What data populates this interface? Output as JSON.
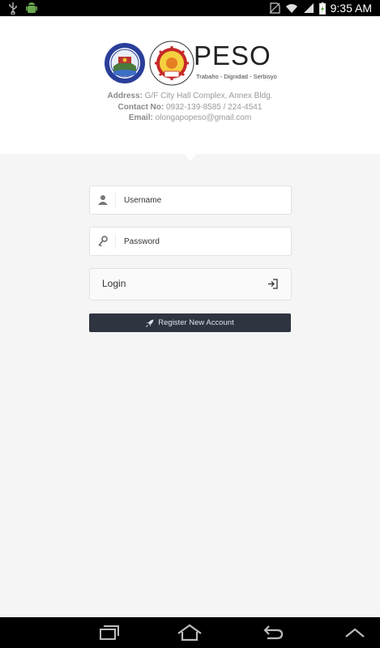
{
  "status_bar": {
    "time": "9:35 AM",
    "left_icons": [
      "usb-icon",
      "android-debug-icon"
    ],
    "right_icons": [
      "no-sim-icon",
      "wifi-icon",
      "signal-icon",
      "battery-charging-icon"
    ]
  },
  "brand": {
    "name": "PESO",
    "tagline": "Trabaho - Dignidad - Serbisyo"
  },
  "contact": {
    "address_label": "Address:",
    "address_value": "G/F City Hall Complex, Annex Bldg.",
    "contact_label": "Contact No:",
    "contact_value": "0932-139-8585 / 224-4541",
    "email_label": "Email:",
    "email_value": "olongapopeso@gmail.com"
  },
  "form": {
    "username_placeholder": "Username",
    "password_placeholder": "Password",
    "login_label": "Login",
    "register_label": "Register New Account"
  },
  "nav_bar": {
    "buttons": [
      "recent-apps-icon",
      "home-icon",
      "back-icon",
      "menu-up-icon"
    ]
  },
  "colors": {
    "background": "#f5f5f6",
    "header": "#ffffff",
    "register_button": "#2e3440",
    "status_bar": "#000000"
  }
}
